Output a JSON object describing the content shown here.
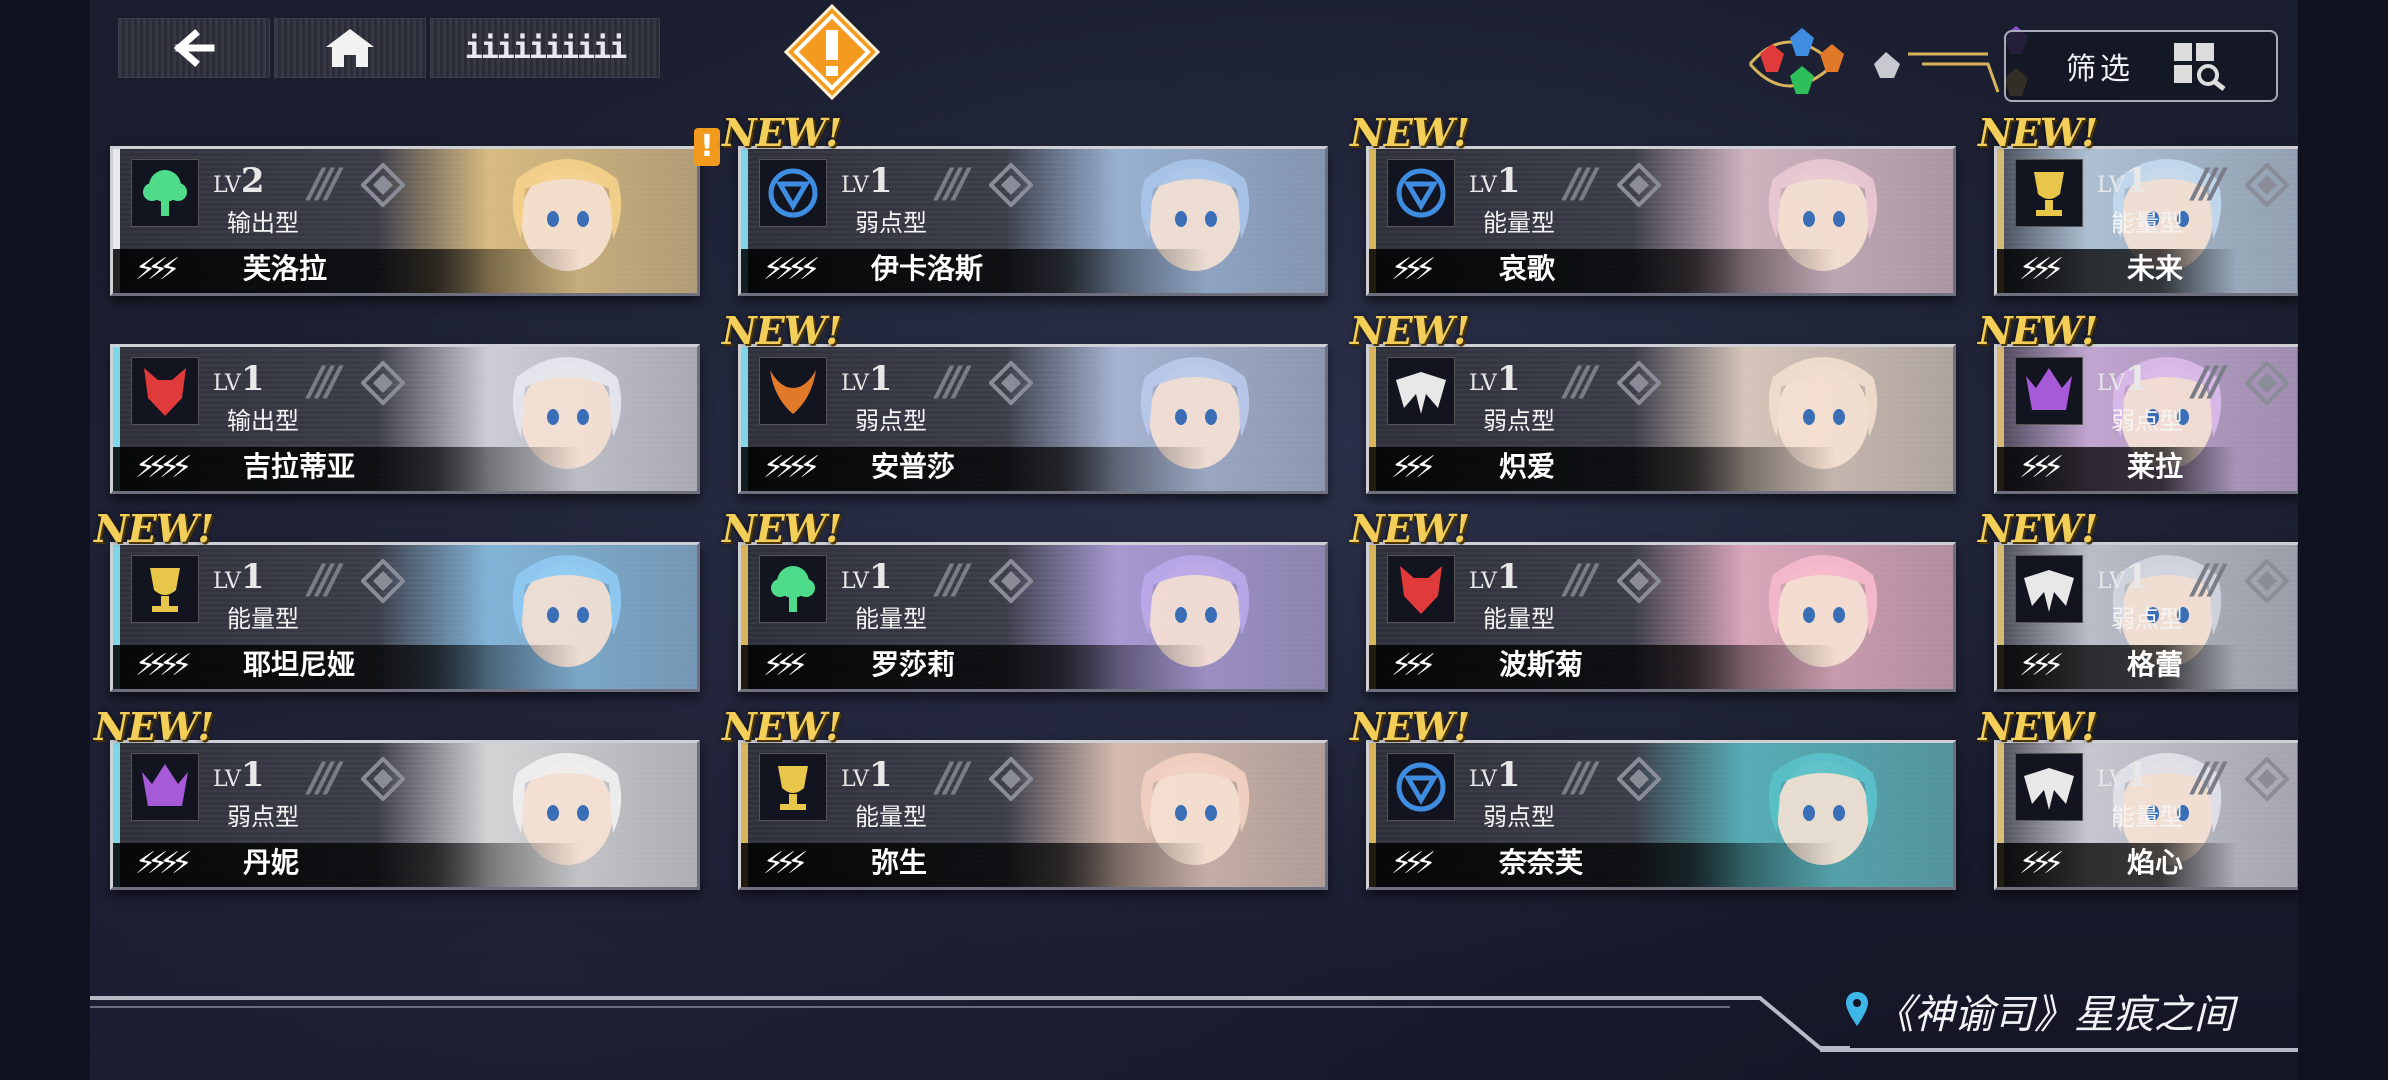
{
  "top_bar": {
    "back_icon": "back-arrow-icon",
    "home_icon": "home-icon",
    "sort_label": "iiiiiiiiii",
    "alert_icon": "alert-diamond-icon",
    "filter_label": "筛选",
    "filter_icon": "grid-search-icon",
    "element_icons": [
      "red-element-icon",
      "blue-element-icon",
      "orange-element-icon",
      "green-element-icon",
      "silver-element-icon",
      "purple-element-icon",
      "yellow-element-icon"
    ]
  },
  "new_label": "NEW!",
  "alert_badge": "!",
  "cards": [
    {
      "lv_prefix": "LV",
      "lv": "2",
      "type": "输出型",
      "stars": "⚡⚡⚡",
      "name": "芙洛拉",
      "new": false,
      "alert": true,
      "icon": "green-tree-icon",
      "color": "#4fdc8a",
      "strip": "#e9e9ee"
    },
    {
      "lv_prefix": "LV",
      "lv": "1",
      "type": "弱点型",
      "stars": "⚡⚡⚡⚡",
      "name": "伊卡洛斯",
      "new": true,
      "alert": false,
      "icon": "blue-crest-icon",
      "color": "#3f8de0",
      "strip": "#7ed6e8"
    },
    {
      "lv_prefix": "LV",
      "lv": "1",
      "type": "能量型",
      "stars": "⚡⚡⚡",
      "name": "哀歌",
      "new": true,
      "alert": false,
      "icon": "blue-crest-icon",
      "color": "#3f8de0",
      "strip": "#d8b55a"
    },
    {
      "lv_prefix": "LV",
      "lv": "1",
      "type": "能量型",
      "stars": "⚡⚡⚡",
      "name": "未来",
      "new": true,
      "alert": false,
      "icon": "gold-trophy-icon",
      "color": "#e8c64a",
      "strip": "#d8b55a"
    },
    {
      "lv_prefix": "LV",
      "lv": "1",
      "type": "输出型",
      "stars": "⚡⚡⚡⚡",
      "name": "吉拉蒂亚",
      "new": false,
      "alert": false,
      "icon": "red-wolf-icon",
      "color": "#e03a3a",
      "strip": "#7ed6e8"
    },
    {
      "lv_prefix": "LV",
      "lv": "1",
      "type": "弱点型",
      "stars": "⚡⚡⚡⚡",
      "name": "安普莎",
      "new": true,
      "alert": false,
      "icon": "orange-horns-icon",
      "color": "#e07a2a",
      "strip": "#7ed6e8"
    },
    {
      "lv_prefix": "LV",
      "lv": "1",
      "type": "弱点型",
      "stars": "⚡⚡⚡",
      "name": "炽爱",
      "new": true,
      "alert": false,
      "icon": "silver-wings-icon",
      "color": "#e8e8e8",
      "strip": "#d8b55a"
    },
    {
      "lv_prefix": "LV",
      "lv": "1",
      "type": "弱点型",
      "stars": "⚡⚡⚡",
      "name": "莱拉",
      "new": true,
      "alert": false,
      "icon": "purple-crown-icon",
      "color": "#a75ad8",
      "strip": "#d8b55a"
    },
    {
      "lv_prefix": "LV",
      "lv": "1",
      "type": "能量型",
      "stars": "⚡⚡⚡⚡",
      "name": "耶坦尼娅",
      "new": true,
      "alert": false,
      "icon": "gold-trophy-icon",
      "color": "#e8c64a",
      "strip": "#7ed6e8"
    },
    {
      "lv_prefix": "LV",
      "lv": "1",
      "type": "能量型",
      "stars": "⚡⚡⚡",
      "name": "罗莎莉",
      "new": true,
      "alert": false,
      "icon": "green-tree-icon",
      "color": "#4fdc8a",
      "strip": "#d8b55a"
    },
    {
      "lv_prefix": "LV",
      "lv": "1",
      "type": "能量型",
      "stars": "⚡⚡⚡",
      "name": "波斯菊",
      "new": true,
      "alert": false,
      "icon": "red-wolf-icon",
      "color": "#e03a3a",
      "strip": "#d8b55a"
    },
    {
      "lv_prefix": "LV",
      "lv": "1",
      "type": "弱点型",
      "stars": "⚡⚡⚡",
      "name": "格蕾",
      "new": true,
      "alert": false,
      "icon": "silver-wings-icon",
      "color": "#e8e8e8",
      "strip": "#d8b55a"
    },
    {
      "lv_prefix": "LV",
      "lv": "1",
      "type": "弱点型",
      "stars": "⚡⚡⚡⚡",
      "name": "丹妮",
      "new": true,
      "alert": false,
      "icon": "purple-crown-icon",
      "color": "#a75ad8",
      "strip": "#7ed6e8"
    },
    {
      "lv_prefix": "LV",
      "lv": "1",
      "type": "能量型",
      "stars": "⚡⚡⚡",
      "name": "弥生",
      "new": true,
      "alert": false,
      "icon": "gold-trophy-icon",
      "color": "#e8c64a",
      "strip": "#d8b55a"
    },
    {
      "lv_prefix": "LV",
      "lv": "1",
      "type": "弱点型",
      "stars": "⚡⚡⚡",
      "name": "奈奈芙",
      "new": true,
      "alert": false,
      "icon": "blue-crest-icon",
      "color": "#3f8de0",
      "strip": "#d8b55a"
    },
    {
      "lv_prefix": "LV",
      "lv": "1",
      "type": "能量型",
      "stars": "⚡⚡⚡",
      "name": "焰心",
      "new": true,
      "alert": false,
      "icon": "silver-wings-icon",
      "color": "#e8e8e8",
      "strip": "#d8b55a"
    }
  ],
  "footer": {
    "location_icon": "map-pin-icon",
    "location": "《神谕司》星痕之间"
  }
}
